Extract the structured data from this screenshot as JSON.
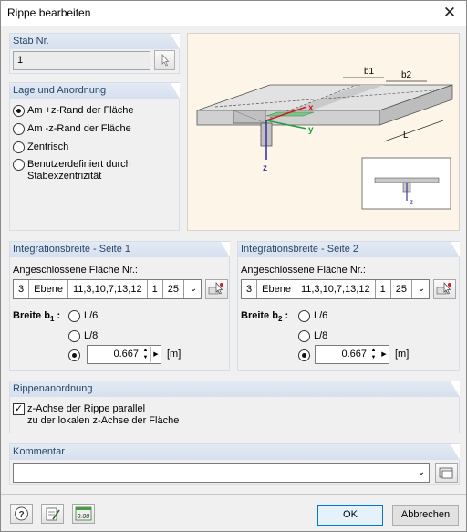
{
  "window": {
    "title": "Rippe bearbeiten",
    "close": "✕"
  },
  "stab": {
    "header": "Stab Nr.",
    "value": "1"
  },
  "lage": {
    "header": "Lage und Anordnung",
    "options": [
      "Am +z-Rand der Fläche",
      "Am -z-Rand der Fläche",
      "Zentrisch",
      "Benutzerdefiniert durch",
      "Stabexzentrizität"
    ],
    "selected": 0
  },
  "diagram": {
    "b1": "b1",
    "b2": "b2",
    "L": "L",
    "x": "x",
    "y": "y",
    "z": "z",
    "z_small": "z"
  },
  "side1": {
    "header": "Integrationsbreite - Seite 1",
    "surface_label": "Angeschlossene Fläche Nr.:",
    "cells": [
      "3",
      "Ebene",
      "11,3,10,7,13,12",
      "1",
      "25"
    ],
    "breite_label": "Breite b",
    "breite_sub": "1",
    "opt1": "L/6",
    "opt2": "L/8",
    "value": "0.667",
    "unit": "[m]"
  },
  "side2": {
    "header": "Integrationsbreite - Seite 2",
    "surface_label": "Angeschlossene Fläche Nr.:",
    "cells": [
      "3",
      "Ebene",
      "11,3,10,7,13,12",
      "1",
      "25"
    ],
    "breite_label": "Breite b",
    "breite_sub": "2",
    "opt1": "L/6",
    "opt2": "L/8",
    "value": "0.667",
    "unit": "[m]"
  },
  "rippen": {
    "header": "Rippenanordnung",
    "check_line1": "z-Achse der Rippe parallel",
    "check_line2": "zu der lokalen z-Achse der Fläche",
    "checked": true
  },
  "kommentar": {
    "header": "Kommentar",
    "value": ""
  },
  "footer": {
    "ok": "OK",
    "cancel": "Abbrechen",
    "units_icon_text": "0.00"
  },
  "colors": {
    "header_text": "#28466a",
    "diagram_bg": "#fdf6e8",
    "axis_x": "#d02020",
    "axis_y": "#20a040",
    "axis_z": "#3a3aa0",
    "ok_border": "#0078d7"
  }
}
